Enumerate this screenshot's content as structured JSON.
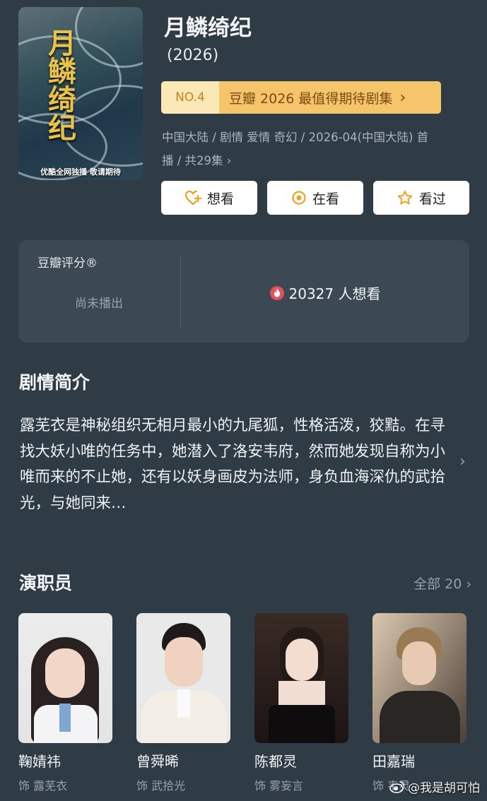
{
  "poster": {
    "title_art": "月鳞绮纪",
    "caption": "优酷全网独播 敬请期待"
  },
  "header": {
    "title": "月鳞绮纪",
    "year": "(2026)"
  },
  "rank": {
    "number": "NO.4",
    "label": "豆瓣 2026 最值得期待剧集",
    "chevron": "›"
  },
  "meta": {
    "line1": "中国大陆 / 剧情 爱情 奇幻 / 2026-04(中国大陆) 首",
    "line2": "播 / 共29集 ›"
  },
  "actions": [
    {
      "label": "想看",
      "icon": "heart-plus-icon"
    },
    {
      "label": "在看",
      "icon": "record-icon"
    },
    {
      "label": "看过",
      "icon": "star-icon"
    }
  ],
  "rating": {
    "label": "豆瓣评分®",
    "status": "尚未播出",
    "want_count": "20327 人想看",
    "icon": "fire-icon"
  },
  "synopsis": {
    "heading": "剧情简介",
    "text": "露芜衣是神秘组织无相月最小的九尾狐，性格活泼，狡黠。在寻找大妖小唯的任务中，她潜入了洛安韦府，然而她发现自称为小唯而来的不止她，还有以妖身画皮为法师，身负血海深仇的武拾光，与她同来…",
    "chevron": "›"
  },
  "cast": {
    "heading": "演职员",
    "all_label": "全部 20 ›",
    "members": [
      {
        "name": "鞠婧祎",
        "role": "饰 露芜衣"
      },
      {
        "name": "曾舜晞",
        "role": "饰 武拾光"
      },
      {
        "name": "陈都灵",
        "role": "饰 雾妄言"
      },
      {
        "name": "田嘉瑞",
        "role": "饰 韦灵"
      }
    ]
  },
  "watermark": {
    "text": "@我是胡可怕",
    "icon": "weibo-icon"
  },
  "colors": {
    "background": "#2f3b45",
    "card": "#3c4853",
    "rank_accent": "#f4c56b",
    "button_icon": "#f0a020"
  }
}
